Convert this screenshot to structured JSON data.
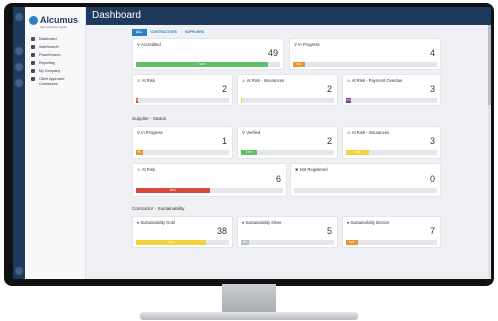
{
  "header": {
    "title": "Dashboard"
  },
  "brand": {
    "name": "Alcumus",
    "tagline": "Safe Contractor Supplier",
    "accent": "#1f3a5c"
  },
  "sidebar": {
    "items": [
      {
        "label": "Dashboard",
        "icon": "home-icon"
      },
      {
        "label": "SafeSearch*",
        "icon": "search-icon"
      },
      {
        "label": "PowerSearch",
        "icon": "search-icon"
      },
      {
        "label": "Reporting",
        "icon": "report-icon"
      },
      {
        "label": "My Company",
        "icon": "building-icon"
      },
      {
        "label": "Client Approved Contractors",
        "icon": "check-icon"
      }
    ]
  },
  "tabs": [
    {
      "label": "ALL"
    },
    {
      "label": "CONTRACTORS"
    },
    {
      "label": "SUPPLIERS"
    }
  ],
  "sections": {
    "supplier_status": "Supplier - Status",
    "contractor_sustainability": "Contractor - Sustainability"
  },
  "cards": {
    "accredited": {
      "title": "Accredited",
      "value": "49",
      "pct_label": "92%",
      "pct": 92,
      "color": "#5fbf6a"
    },
    "in_progress_top": {
      "title": "In Progress",
      "value": "4",
      "pct_label": "8%",
      "pct": 8,
      "color": "#e8962f"
    },
    "at_risk_top": {
      "title": "At Risk",
      "value": "2",
      "pct_label": "2%",
      "pct": 2,
      "color": "#d94a3d"
    },
    "at_risk_ins_top": {
      "title": "At Risk - Insurances",
      "value": "2",
      "pct_label": "",
      "pct": 1,
      "color": "#f2d13a"
    },
    "at_risk_pay": {
      "title": "At Risk - Payment Overdue",
      "value": "3",
      "pct_label": "6%",
      "pct": 6,
      "color": "#7a3fa0"
    },
    "sup_in_progress": {
      "title": "In Progress",
      "value": "1",
      "pct_label": "7%",
      "pct": 7,
      "color": "#e8962f"
    },
    "sup_verified": {
      "title": "Verified",
      "value": "2",
      "pct_label": "17%",
      "pct": 17,
      "color": "#5fbf6a"
    },
    "sup_at_risk_ins": {
      "title": "At Risk - Insurances",
      "value": "3",
      "pct_label": "25%",
      "pct": 25,
      "color": "#f2d13a"
    },
    "sup_at_risk": {
      "title": "At Risk",
      "value": "6",
      "pct_label": "50%",
      "pct": 50,
      "color": "#d94a3d"
    },
    "sup_not_registered": {
      "title": "Not Registered",
      "value": "0",
      "pct_label": "",
      "pct": 0,
      "color": "#9aa0a6"
    },
    "sus_gold": {
      "title": "Sustainability Gold",
      "value": "38",
      "pct_label": "75%",
      "pct": 75,
      "color": "#f2d13a"
    },
    "sus_silver": {
      "title": "Sustainability Silver",
      "value": "5",
      "pct_label": "9%",
      "pct": 9,
      "color": "#b9bec5"
    },
    "sus_bronze": {
      "title": "Sustainability Bronze",
      "value": "7",
      "pct_label": "13%",
      "pct": 13,
      "color": "#e8962f"
    }
  }
}
